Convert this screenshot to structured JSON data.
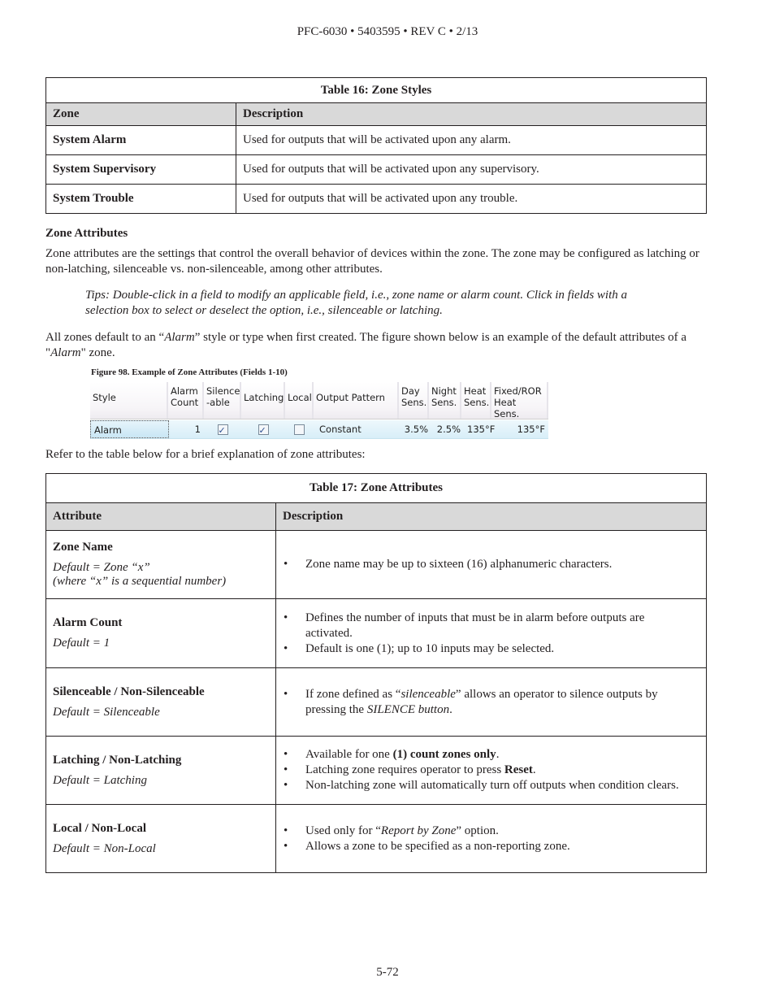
{
  "header": "PFC-6030 • 5403595 • REV C • 2/13",
  "footer": "5-72",
  "table16": {
    "caption": "Table 16: Zone Styles",
    "headers": [
      "Zone",
      "Description"
    ],
    "rows": [
      [
        "System Alarm",
        "Used for outputs that will be activated upon any alarm."
      ],
      [
        "System Supervisory",
        "Used for outputs that will be activated upon any supervisory."
      ],
      [
        "System Trouble",
        "Used for outputs that will be activated upon any trouble."
      ]
    ]
  },
  "zone_attributes": {
    "heading": "Zone Attributes",
    "para1": "Zone attributes are the settings that control the overall behavior of devices within the zone. The zone may be configured as latching or non-latching, silenceable vs. non-silenceable, among other attributes.",
    "tips": "Tips: Double-click in a field to modify an applicable field, i.e., zone name or alarm count. Click in fields with a selection box to select or deselect the option, i.e., silenceable or latching.",
    "para2_a": "All zones default to an “",
    "para2_b": "Alarm",
    "para2_c": "” style or type when first created. The figure shown below is an example of the default attributes of a \"",
    "para2_d": "Alarm",
    "para2_e": "\" zone."
  },
  "figure98": {
    "caption": "Figure 98. Example of Zone Attributes (Fields 1-10)",
    "columns": [
      "Style",
      "Alarm Count",
      "Silence -able",
      "Latching",
      "Local",
      "Output Pattern",
      "Day Sens.",
      "Night Sens.",
      "Heat Sens.",
      "Fixed/ROR Heat Sens."
    ],
    "row": {
      "style": "Alarm",
      "alarm_count": "1",
      "silenceable": true,
      "latching": true,
      "local": false,
      "output_pattern": "Constant",
      "day_sens": "3.5%",
      "night_sens": "2.5%",
      "heat_sens": "135°F",
      "fixed_ror_heat_sens": "135°F"
    }
  },
  "refer_text": "Refer to the table below for a brief explanation of zone attributes:",
  "table17": {
    "caption": "Table 17: Zone Attributes",
    "headers": [
      "Attribute",
      "Description"
    ],
    "rows": [
      {
        "name": "Zone Name",
        "default": "Default = Zone “x”",
        "default2": "(where “x” is a sequential number)",
        "bullets": [
          "Zone name may be up to sixteen (16) alphanumeric characters."
        ]
      },
      {
        "name": "Alarm Count",
        "default": "Default = 1",
        "bullets": [
          "Defines the number of inputs that must be in alarm before outputs are activated.",
          "Default is one (1); up to 10 inputs may be selected."
        ]
      },
      {
        "name": "Silenceable / Non-Silenceable",
        "default": "Default = Silenceable",
        "bullet_a": "If zone defined as “",
        "bullet_b": "silenceable",
        "bullet_c": "” allows an operator to silence outputs by pressing the ",
        "bullet_d": "SILENCE button",
        "bullet_e": "."
      },
      {
        "name": "Latching / Non-Latching",
        "default": "Default = Latching",
        "b1_a": "Available for one ",
        "b1_b": "(1) count zones only",
        "b1_c": ".",
        "b2_a": "Latching zone requires operator to press ",
        "b2_b": "Reset",
        "b2_c": ".",
        "b3": "Non-latching zone will automatically turn off outputs when condition clears."
      },
      {
        "name": "Local / Non-Local",
        "default": "Default = Non-Local",
        "b1_a": "Used only for “",
        "b1_b": "Report by Zone",
        "b1_c": "” option.",
        "b2": "Allows a zone to be specified as a non-reporting zone."
      }
    ]
  }
}
